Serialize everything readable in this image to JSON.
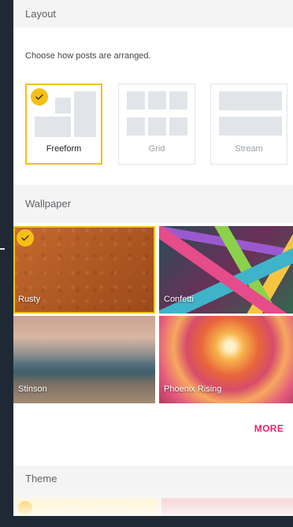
{
  "layout": {
    "header": "Layout",
    "description": "Choose how posts are arranged.",
    "options": [
      {
        "label": "Freeform",
        "selected": true
      },
      {
        "label": "Grid",
        "selected": false
      },
      {
        "label": "Stream",
        "selected": false
      }
    ]
  },
  "wallpaper": {
    "header": "Wallpaper",
    "items": [
      {
        "label": "Rusty",
        "selected": true
      },
      {
        "label": "Confetti",
        "selected": false
      },
      {
        "label": "Stinson",
        "selected": false
      },
      {
        "label": "Phoenix Rising",
        "selected": false
      }
    ],
    "more_label": "MORE"
  },
  "theme": {
    "header": "Theme"
  },
  "colors": {
    "accent_yellow": "#f4c016",
    "more_pink": "#e2226e",
    "page_bg": "#1f2935"
  },
  "icons": {
    "check": "check-icon"
  }
}
